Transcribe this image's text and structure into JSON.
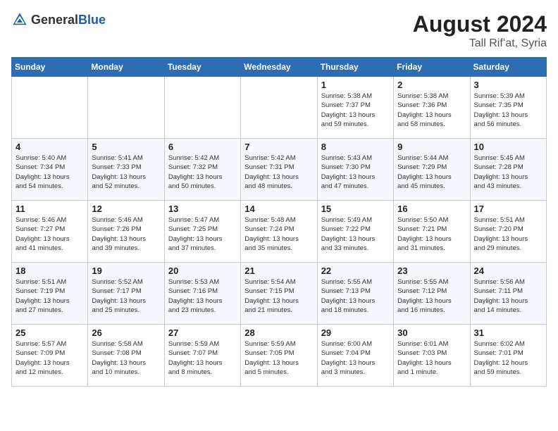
{
  "header": {
    "logo_general": "General",
    "logo_blue": "Blue",
    "month_year": "August 2024",
    "location": "Tall Rifʻat, Syria"
  },
  "weekdays": [
    "Sunday",
    "Monday",
    "Tuesday",
    "Wednesday",
    "Thursday",
    "Friday",
    "Saturday"
  ],
  "weeks": [
    [
      {
        "day": "",
        "info": ""
      },
      {
        "day": "",
        "info": ""
      },
      {
        "day": "",
        "info": ""
      },
      {
        "day": "",
        "info": ""
      },
      {
        "day": "1",
        "info": "Sunrise: 5:38 AM\nSunset: 7:37 PM\nDaylight: 13 hours\nand 59 minutes."
      },
      {
        "day": "2",
        "info": "Sunrise: 5:38 AM\nSunset: 7:36 PM\nDaylight: 13 hours\nand 58 minutes."
      },
      {
        "day": "3",
        "info": "Sunrise: 5:39 AM\nSunset: 7:35 PM\nDaylight: 13 hours\nand 56 minutes."
      }
    ],
    [
      {
        "day": "4",
        "info": "Sunrise: 5:40 AM\nSunset: 7:34 PM\nDaylight: 13 hours\nand 54 minutes."
      },
      {
        "day": "5",
        "info": "Sunrise: 5:41 AM\nSunset: 7:33 PM\nDaylight: 13 hours\nand 52 minutes."
      },
      {
        "day": "6",
        "info": "Sunrise: 5:42 AM\nSunset: 7:32 PM\nDaylight: 13 hours\nand 50 minutes."
      },
      {
        "day": "7",
        "info": "Sunrise: 5:42 AM\nSunset: 7:31 PM\nDaylight: 13 hours\nand 48 minutes."
      },
      {
        "day": "8",
        "info": "Sunrise: 5:43 AM\nSunset: 7:30 PM\nDaylight: 13 hours\nand 47 minutes."
      },
      {
        "day": "9",
        "info": "Sunrise: 5:44 AM\nSunset: 7:29 PM\nDaylight: 13 hours\nand 45 minutes."
      },
      {
        "day": "10",
        "info": "Sunrise: 5:45 AM\nSunset: 7:28 PM\nDaylight: 13 hours\nand 43 minutes."
      }
    ],
    [
      {
        "day": "11",
        "info": "Sunrise: 5:46 AM\nSunset: 7:27 PM\nDaylight: 13 hours\nand 41 minutes."
      },
      {
        "day": "12",
        "info": "Sunrise: 5:46 AM\nSunset: 7:26 PM\nDaylight: 13 hours\nand 39 minutes."
      },
      {
        "day": "13",
        "info": "Sunrise: 5:47 AM\nSunset: 7:25 PM\nDaylight: 13 hours\nand 37 minutes."
      },
      {
        "day": "14",
        "info": "Sunrise: 5:48 AM\nSunset: 7:24 PM\nDaylight: 13 hours\nand 35 minutes."
      },
      {
        "day": "15",
        "info": "Sunrise: 5:49 AM\nSunset: 7:22 PM\nDaylight: 13 hours\nand 33 minutes."
      },
      {
        "day": "16",
        "info": "Sunrise: 5:50 AM\nSunset: 7:21 PM\nDaylight: 13 hours\nand 31 minutes."
      },
      {
        "day": "17",
        "info": "Sunrise: 5:51 AM\nSunset: 7:20 PM\nDaylight: 13 hours\nand 29 minutes."
      }
    ],
    [
      {
        "day": "18",
        "info": "Sunrise: 5:51 AM\nSunset: 7:19 PM\nDaylight: 13 hours\nand 27 minutes."
      },
      {
        "day": "19",
        "info": "Sunrise: 5:52 AM\nSunset: 7:17 PM\nDaylight: 13 hours\nand 25 minutes."
      },
      {
        "day": "20",
        "info": "Sunrise: 5:53 AM\nSunset: 7:16 PM\nDaylight: 13 hours\nand 23 minutes."
      },
      {
        "day": "21",
        "info": "Sunrise: 5:54 AM\nSunset: 7:15 PM\nDaylight: 13 hours\nand 21 minutes."
      },
      {
        "day": "22",
        "info": "Sunrise: 5:55 AM\nSunset: 7:13 PM\nDaylight: 13 hours\nand 18 minutes."
      },
      {
        "day": "23",
        "info": "Sunrise: 5:55 AM\nSunset: 7:12 PM\nDaylight: 13 hours\nand 16 minutes."
      },
      {
        "day": "24",
        "info": "Sunrise: 5:56 AM\nSunset: 7:11 PM\nDaylight: 13 hours\nand 14 minutes."
      }
    ],
    [
      {
        "day": "25",
        "info": "Sunrise: 5:57 AM\nSunset: 7:09 PM\nDaylight: 13 hours\nand 12 minutes."
      },
      {
        "day": "26",
        "info": "Sunrise: 5:58 AM\nSunset: 7:08 PM\nDaylight: 13 hours\nand 10 minutes."
      },
      {
        "day": "27",
        "info": "Sunrise: 5:59 AM\nSunset: 7:07 PM\nDaylight: 13 hours\nand 8 minutes."
      },
      {
        "day": "28",
        "info": "Sunrise: 5:59 AM\nSunset: 7:05 PM\nDaylight: 13 hours\nand 5 minutes."
      },
      {
        "day": "29",
        "info": "Sunrise: 6:00 AM\nSunset: 7:04 PM\nDaylight: 13 hours\nand 3 minutes."
      },
      {
        "day": "30",
        "info": "Sunrise: 6:01 AM\nSunset: 7:03 PM\nDaylight: 13 hours\nand 1 minute."
      },
      {
        "day": "31",
        "info": "Sunrise: 6:02 AM\nSunset: 7:01 PM\nDaylight: 12 hours\nand 59 minutes."
      }
    ]
  ]
}
